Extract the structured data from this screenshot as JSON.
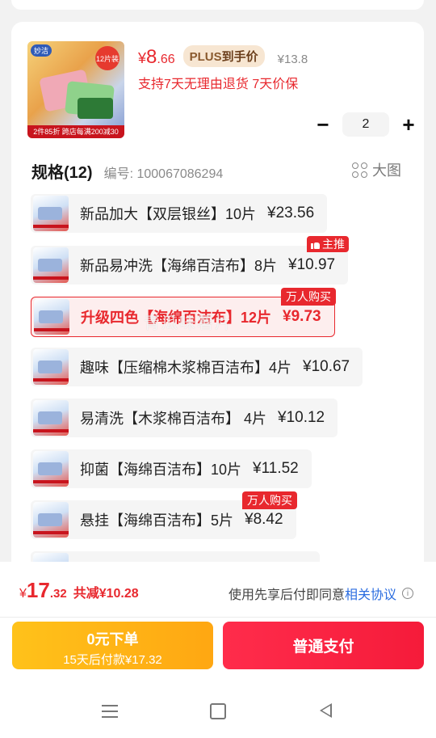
{
  "product": {
    "currency": "¥",
    "price_int": "8",
    "price_dec": ".66",
    "plus_label": "PLUS",
    "plus_suffix": "到手价",
    "orig_price": "¥13.8",
    "promo": "支持7天无理由退货  7天价保",
    "thumb_logo": "妙洁",
    "thumb_badge": "12片装",
    "thumb_strip": "2件85折 跨店每满200减30"
  },
  "quantity": {
    "minus": "−",
    "value": "2",
    "plus": "+"
  },
  "spec": {
    "title": "规格(12)",
    "code": "编号: 100067086294",
    "big_view": "大图",
    "options": [
      {
        "label": "新品加大【双层银丝】10片",
        "price": "¥23.56"
      },
      {
        "label": "新品易冲洗【海绵百洁布】8片",
        "price": "¥10.97"
      },
      {
        "label": "升级四色【海绵百洁布】12片",
        "price": "¥9.73"
      },
      {
        "label": "趣味【压缩棉木浆棉百洁布】4片",
        "price": "¥10.67"
      },
      {
        "label": "易清洗【木浆棉百洁布】 4片",
        "price": "¥10.12"
      },
      {
        "label": "抑菌【海绵百洁布】10片",
        "price": "¥11.52"
      },
      {
        "label": "悬挂【海绵百洁布】5片",
        "price": "¥8.42"
      }
    ],
    "tag_main": "主推",
    "tag_hot_1": "万人购买",
    "tag_hot_2": "万人购买"
  },
  "watermark": "青瓜味薯片",
  "footer": {
    "currency": "¥",
    "total_int": "17",
    "total_dec": ".32",
    "saved": "共减¥10.28",
    "agree_prefix": "使用先享后付即同意",
    "agree_link": "相关协议",
    "info": "i",
    "later_line1": "0元下单",
    "later_line2": "15天后付款¥17.32",
    "pay_label": "普通支付"
  },
  "colors": {
    "accent": "#e8282e",
    "pay": "#f51b3a",
    "later": "#ffb516",
    "link": "#2b6de0"
  }
}
